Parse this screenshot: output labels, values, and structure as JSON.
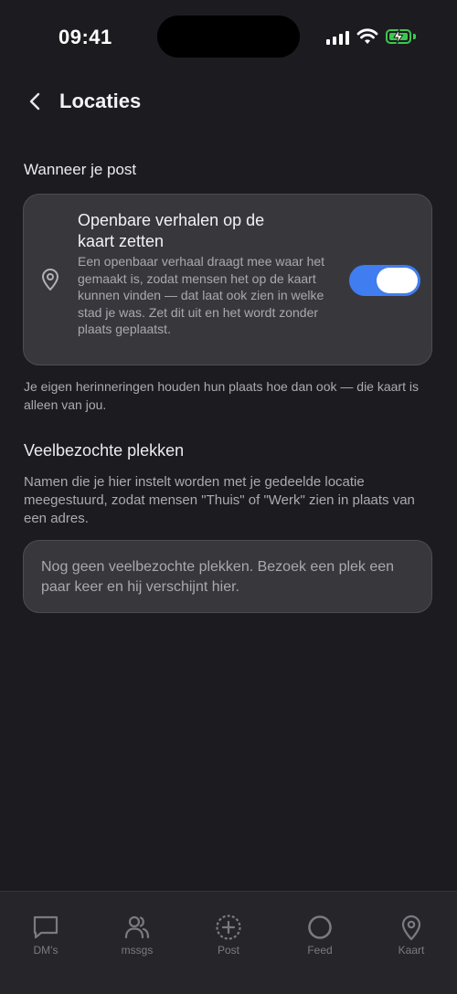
{
  "status_bar": {
    "time": "09:41"
  },
  "header": {
    "title": "Locaties"
  },
  "post_section": {
    "heading": "Wanneer je post",
    "card": {
      "title": "Openbare verhalen op de kaart zetten",
      "description": "Een openbaar verhaal draagt mee waar het gemaakt is, zodat mensen het op de kaart kunnen vinden — dat laat ook zien in welke stad je was. Zet dit uit en het wordt zonder plaats geplaatst.",
      "toggle_on": true,
      "icon": "location-pin-icon"
    },
    "footnote": "Je eigen herinneringen houden hun plaats hoe dan ook — die kaart is alleen van jou."
  },
  "places_section": {
    "heading": "Veelbezochte plekken",
    "description": "Namen die je hier instelt worden met je gedeelde locatie meegestuurd, zodat mensen \"Thuis\" of \"Werk\" zien in plaats van een adres.",
    "empty_state": "Nog geen veelbezochte plekken. Bezoek een plek een paar keer en hij verschijnt hier."
  },
  "tabs": [
    {
      "label": "DM's",
      "icon": "chat-bubble-icon"
    },
    {
      "label": "mssgs",
      "icon": "people-icon"
    },
    {
      "label": "Post",
      "icon": "plus-circle-icon"
    },
    {
      "label": "Feed",
      "icon": "circle-icon"
    },
    {
      "label": "Kaart",
      "icon": "location-pin-icon"
    }
  ],
  "colors": {
    "background": "#1c1c20",
    "card": "#38383c",
    "toggle_accent": "#3f7df0",
    "battery": "#3ec74f"
  }
}
